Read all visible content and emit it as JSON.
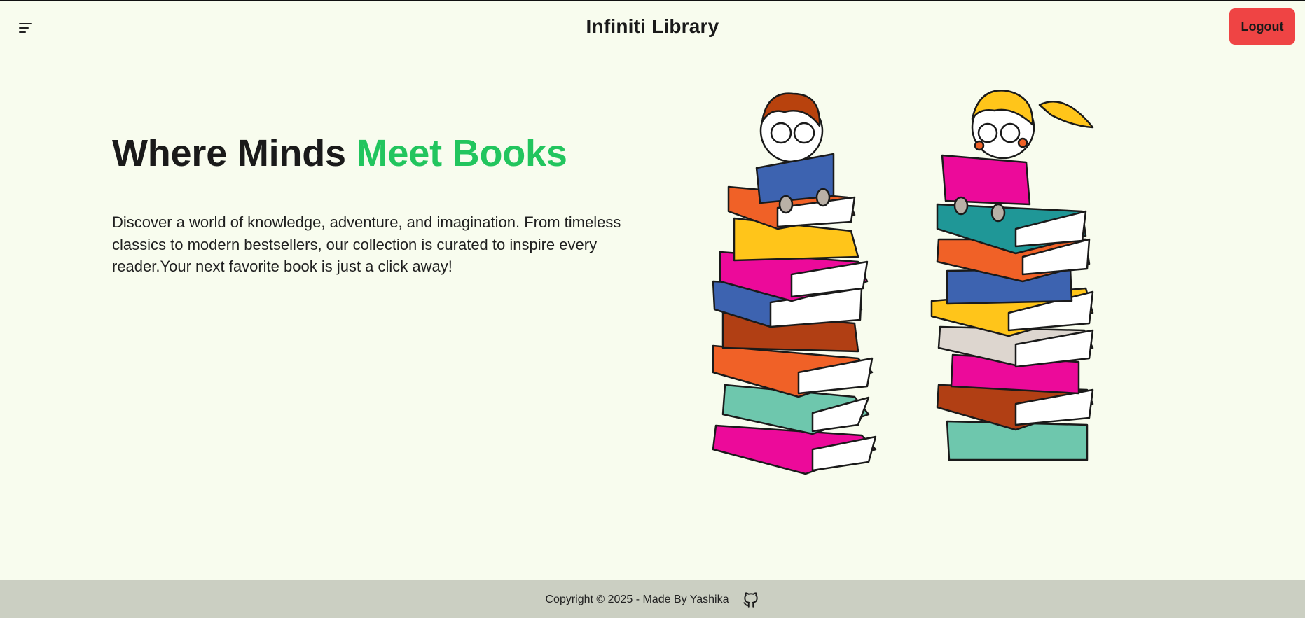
{
  "header": {
    "title": "Infiniti Library",
    "menu_icon": "hamburger-menu-icon",
    "logout_label": "Logout",
    "logout_color": "#ef4444"
  },
  "hero": {
    "title_part1": "Where Minds ",
    "title_part2": "Meet Books",
    "accent_color": "#22c55e",
    "description": "Discover a world of knowledge, adventure, and imagination. From timeless classics to modern bestsellers, our collection is curated to inspire every reader.Your next favorite book is just a click away!"
  },
  "illustration": {
    "subject": "two children reading on stacks of books"
  },
  "footer": {
    "copyright": "Copyright © 2025 - Made By Yashika",
    "github_icon": "github-icon"
  },
  "colors": {
    "background": "#f8fcee",
    "footer_bg": "#cbcfc2"
  }
}
